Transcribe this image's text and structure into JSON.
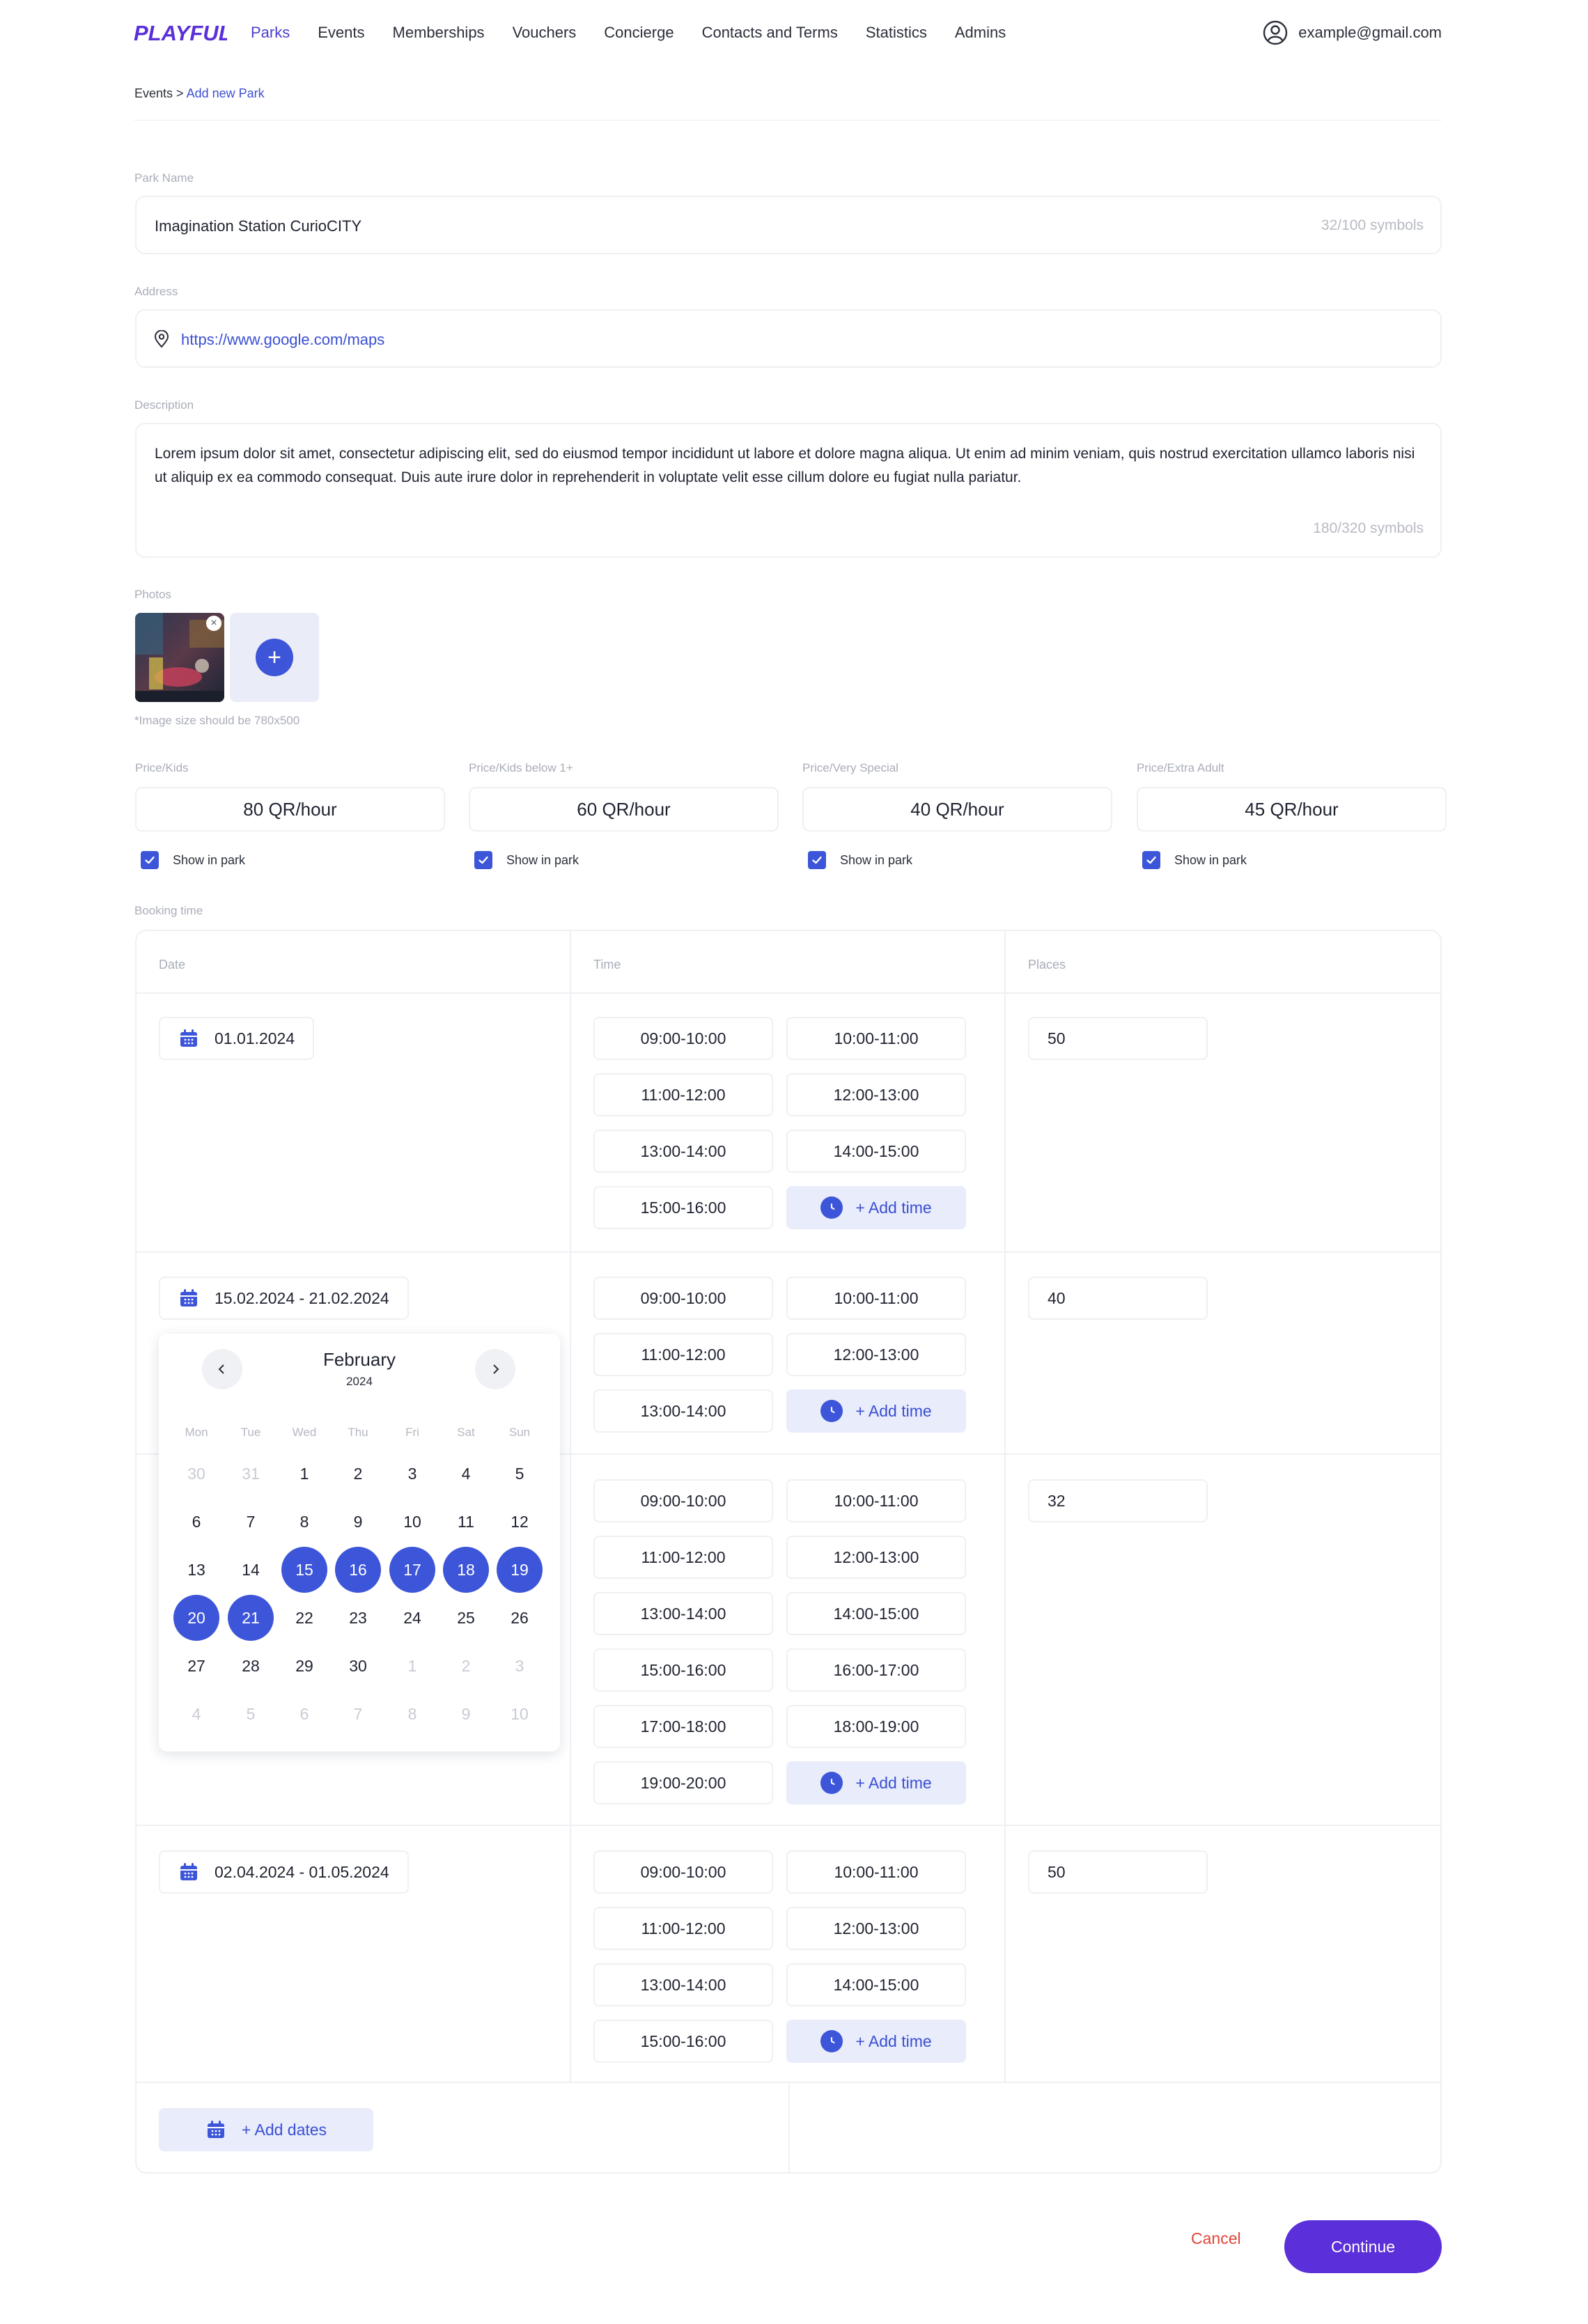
{
  "header": {
    "logo_text": "PLAYFULL",
    "nav": [
      "Parks",
      "Events",
      "Memberships",
      "Vouchers",
      "Concierge",
      "Contacts and Terms",
      "Statistics",
      "Admins"
    ],
    "active_nav": "Parks",
    "user_email": "example@gmail.com"
  },
  "breadcrumb": {
    "parent": "Events",
    "separator": ">",
    "current": "Add new Park"
  },
  "park_name": {
    "label": "Park Name",
    "value": "Imagination Station CurioCITY",
    "counter": "32/100 symbols"
  },
  "address": {
    "label": "Address",
    "value": "https://www.google.com/maps"
  },
  "description": {
    "label": "Description",
    "value": "Lorem ipsum dolor sit amet, consectetur adipiscing elit, sed do eiusmod tempor incididunt ut labore et dolore magna aliqua. Ut enim ad minim veniam, quis nostrud exercitation ullamco laboris nisi ut aliquip ex ea commodo consequat. Duis aute irure dolor in reprehenderit in voluptate velit esse cillum dolore eu fugiat nulla pariatur.",
    "counter": "180/320 symbols"
  },
  "photos": {
    "label": "Photos",
    "hint": "*Image size should be 780x500",
    "add_symbol": "+",
    "remove_symbol": "×"
  },
  "prices": [
    {
      "label": "Price/Kids",
      "value": "80 QR/hour",
      "show_label": "Show in park",
      "checked": true
    },
    {
      "label": "Price/Kids below 1+",
      "value": "60 QR/hour",
      "show_label": "Show in park",
      "checked": true
    },
    {
      "label": "Price/Very Special",
      "value": "40 QR/hour",
      "show_label": "Show in park",
      "checked": true
    },
    {
      "label": "Price/Extra Adult",
      "value": "45 QR/hour",
      "show_label": "Show in park",
      "checked": true
    }
  ],
  "booking": {
    "label": "Booking time",
    "columns": {
      "date": "Date",
      "time": "Time",
      "places": "Places"
    },
    "add_time_label": "+ Add time",
    "add_dates_label": "+ Add dates",
    "rows": [
      {
        "date": "01.01.2024",
        "times": [
          "09:00-10:00",
          "10:00-11:00",
          "11:00-12:00",
          "12:00-13:00",
          "13:00-14:00",
          "14:00-15:00",
          "15:00-16:00"
        ],
        "places": "50"
      },
      {
        "date": "15.02.2024 - 21.02.2024",
        "times": [
          "09:00-10:00",
          "10:00-11:00",
          "11:00-12:00",
          "12:00-13:00",
          "13:00-14:00"
        ],
        "places": "40"
      },
      {
        "date": "",
        "times": [
          "09:00-10:00",
          "10:00-11:00",
          "11:00-12:00",
          "12:00-13:00",
          "13:00-14:00",
          "14:00-15:00",
          "15:00-16:00",
          "16:00-17:00",
          "17:00-18:00",
          "18:00-19:00",
          "19:00-20:00"
        ],
        "places": "32"
      },
      {
        "date": "02.04.2024 - 01.05.2024",
        "times": [
          "09:00-10:00",
          "10:00-11:00",
          "11:00-12:00",
          "12:00-13:00",
          "13:00-14:00",
          "14:00-15:00",
          "15:00-16:00"
        ],
        "places": "50"
      }
    ]
  },
  "calendar": {
    "month": "February",
    "year": "2024",
    "weekdays": [
      "Mon",
      "Tue",
      "Wed",
      "Thu",
      "Fri",
      "Sat",
      "Sun"
    ],
    "weeks": [
      [
        [
          "30",
          "muted"
        ],
        [
          "31",
          "muted"
        ],
        [
          "1",
          ""
        ],
        [
          "2",
          ""
        ],
        [
          "3",
          ""
        ],
        [
          "4",
          ""
        ],
        [
          "5",
          ""
        ]
      ],
      [
        [
          "6",
          ""
        ],
        [
          "7",
          ""
        ],
        [
          "8",
          ""
        ],
        [
          "9",
          ""
        ],
        [
          "10",
          ""
        ],
        [
          "11",
          ""
        ],
        [
          "12",
          ""
        ]
      ],
      [
        [
          "13",
          ""
        ],
        [
          "14",
          ""
        ],
        [
          "15",
          "sel"
        ],
        [
          "16",
          "sel"
        ],
        [
          "17",
          "sel"
        ],
        [
          "18",
          "sel"
        ],
        [
          "19",
          "sel"
        ]
      ],
      [
        [
          "20",
          "sel"
        ],
        [
          "21",
          "sel"
        ],
        [
          "22",
          ""
        ],
        [
          "23",
          ""
        ],
        [
          "24",
          ""
        ],
        [
          "25",
          ""
        ],
        [
          "26",
          ""
        ]
      ],
      [
        [
          "27",
          ""
        ],
        [
          "28",
          ""
        ],
        [
          "29",
          ""
        ],
        [
          "30",
          ""
        ],
        [
          "1",
          "muted"
        ],
        [
          "2",
          "muted"
        ],
        [
          "3",
          "muted"
        ]
      ],
      [
        [
          "4",
          "muted"
        ],
        [
          "5",
          "muted"
        ],
        [
          "6",
          "muted"
        ],
        [
          "7",
          "muted"
        ],
        [
          "8",
          "muted"
        ],
        [
          "9",
          "muted"
        ],
        [
          "10",
          "muted"
        ]
      ]
    ]
  },
  "actions": {
    "cancel": "Cancel",
    "continue": "Continue"
  },
  "colors": {
    "accent": "#3d55d8",
    "brand": "#5b2fd9",
    "danger": "#e0453a"
  }
}
